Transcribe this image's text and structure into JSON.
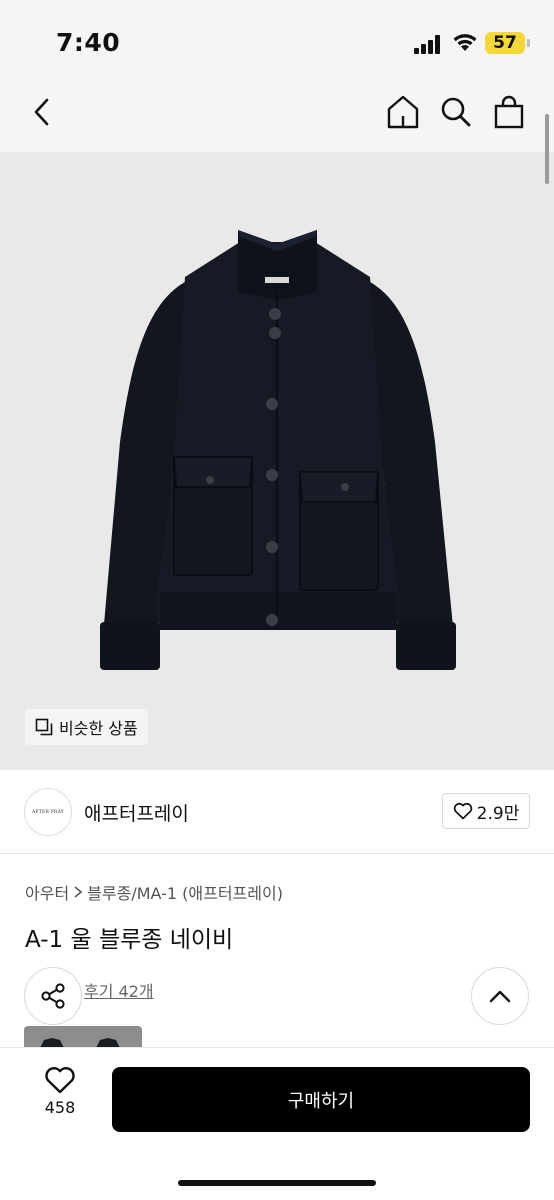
{
  "status_bar": {
    "time": "7:40",
    "battery": "57",
    "battery_color": "#f4d83a"
  },
  "nav": {
    "back_icon": "chevron-left-icon",
    "home_icon": "home-icon",
    "search_icon": "search-icon",
    "bag_icon": "shopping-bag-icon"
  },
  "product_image": {
    "similar_button_label": "비슷한 상품"
  },
  "shop": {
    "logo_text": "AFTER PRAY",
    "name": "애프터프레이",
    "like_count": "2.9만"
  },
  "category": {
    "level1": "아우터",
    "level2": "블루종/MA-1 (애프터프레이)"
  },
  "product": {
    "title": "A-1 울 블루종 네이비",
    "review_link": "후기 42개"
  },
  "bottom_bar": {
    "wish_count": "458",
    "buy_label": "구매하기",
    "buy_color": "#000000"
  }
}
